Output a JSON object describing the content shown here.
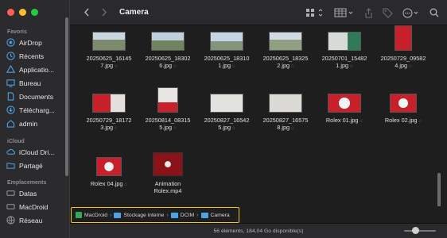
{
  "window": {
    "title": "Camera"
  },
  "sidebar": {
    "sections": [
      {
        "label": "Favoris"
      },
      {
        "label": "iCloud"
      },
      {
        "label": "Emplacements"
      }
    ],
    "items": [
      {
        "label": "AirDrop",
        "icon": "airdrop-icon"
      },
      {
        "label": "Récents",
        "icon": "clock-icon"
      },
      {
        "label": "Applicatio...",
        "icon": "applications-icon"
      },
      {
        "label": "Bureau",
        "icon": "desktop-icon"
      },
      {
        "label": "Documents",
        "icon": "document-icon"
      },
      {
        "label": "Télécharg...",
        "icon": "download-icon"
      },
      {
        "label": "admin",
        "icon": "home-icon"
      },
      {
        "label": "iCloud Dri...",
        "icon": "cloud-icon"
      },
      {
        "label": "Partagé",
        "icon": "shared-folder-icon"
      },
      {
        "label": "Datas",
        "icon": "drive-icon"
      },
      {
        "label": "MacDroid",
        "icon": "drive-icon"
      },
      {
        "label": "Réseau",
        "icon": "network-icon"
      }
    ]
  },
  "files": [
    {
      "name": "20250625_161457.jpg",
      "line1": "20250625_16145",
      "line2": "7.jpg"
    },
    {
      "name": "20250625_183026.jpg",
      "line1": "20250625_18302",
      "line2": "6.jpg"
    },
    {
      "name": "20250625_183101.jpg",
      "line1": "20250625_18310",
      "line2": "1.jpg"
    },
    {
      "name": "20250625_183252.jpg",
      "line1": "20250625_18325",
      "line2": "2.jpg"
    },
    {
      "name": "20250701_154821.jpg",
      "line1": "20250701_15482",
      "line2": "1.jpg"
    },
    {
      "name": "20250729_095824.jpg",
      "line1": "20250729_09582",
      "line2": "4.jpg"
    },
    {
      "name": "20250729_181723.jpg",
      "line1": "20250729_18172",
      "line2": "3.jpg"
    },
    {
      "name": "20250814_083155.jpg",
      "line1": "20250814_08315",
      "line2": "5.jpg"
    },
    {
      "name": "20250827_165425.jpg",
      "line1": "20250827_16542",
      "line2": "5.jpg"
    },
    {
      "name": "20250827_165758.jpg",
      "line1": "20250827_16575",
      "line2": "8.jpg"
    },
    {
      "name": "Rolex 01.jpg",
      "line1": "Rolex 01.jpg",
      "line2": ""
    },
    {
      "name": "Rolex 02.jpg",
      "line1": "Rolex 02.jpg",
      "line2": ""
    },
    {
      "name": "Rolex 04.jpg",
      "line1": "Rolex 04.jpg",
      "line2": ""
    },
    {
      "name": "Animation Rolex.mp4",
      "line1": "Animation",
      "line2": "Rolex.mp4"
    }
  ],
  "pathbar": {
    "crumbs": [
      "MacDroid",
      "Stockage interne",
      "DCIM",
      "Camera"
    ]
  },
  "status": {
    "text": "56 éléments, 184,04 Go disponible(s)"
  },
  "colors": {
    "highlight_border": "#f5c518",
    "folder_blue": "#4ba3e3",
    "accent_red": "#c8202a"
  }
}
